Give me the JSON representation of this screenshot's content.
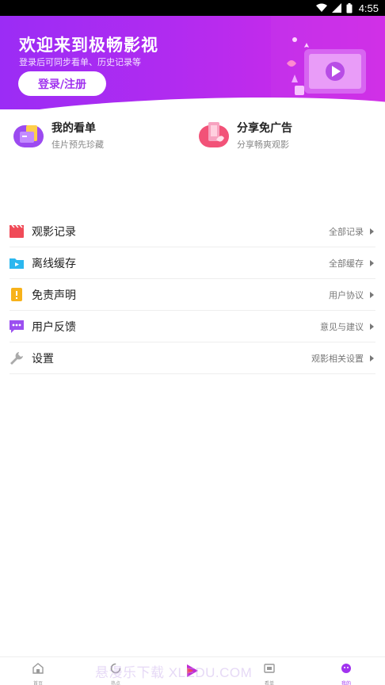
{
  "status_bar": {
    "time": "4:55"
  },
  "header": {
    "title": "欢迎来到极畅影视",
    "subtitle": "登录后可同步看单、历史记录等",
    "login_label": "登录/注册"
  },
  "quick_actions": [
    {
      "title": "我的看单",
      "subtitle": "佳片预先珍藏"
    },
    {
      "title": "分享免广告",
      "subtitle": "分享畅爽观影"
    }
  ],
  "menu": [
    {
      "label": "观影记录",
      "right": "全部记录",
      "icon": "film-clapper-icon",
      "color": "#f04b58"
    },
    {
      "label": "离线缓存",
      "right": "全部缓存",
      "icon": "folder-play-icon",
      "color": "#2bb7ef"
    },
    {
      "label": "免责声明",
      "right": "用户协议",
      "icon": "notice-icon",
      "color": "#f7b21a"
    },
    {
      "label": "用户反馈",
      "right": "意见与建议",
      "icon": "chat-dots-icon",
      "color": "#9b4ff0"
    },
    {
      "label": "设置",
      "right": "观影相关设置",
      "icon": "wrench-icon",
      "color": "#aaaaaa"
    }
  ],
  "bottom_nav": [
    {
      "label": "首页",
      "icon": "home-icon"
    },
    {
      "label": "热点",
      "icon": "hot-icon"
    },
    {
      "label": "",
      "icon": "play-logo-icon"
    },
    {
      "label": "看单",
      "icon": "watchlist-icon"
    },
    {
      "label": "我的",
      "icon": "profile-icon"
    }
  ],
  "watermark": "悬漫乐下载 XLEDU.COM",
  "colors": {
    "accent": "#a133ef",
    "gradient_start": "#9b2cf5",
    "gradient_end": "#d52be6"
  }
}
